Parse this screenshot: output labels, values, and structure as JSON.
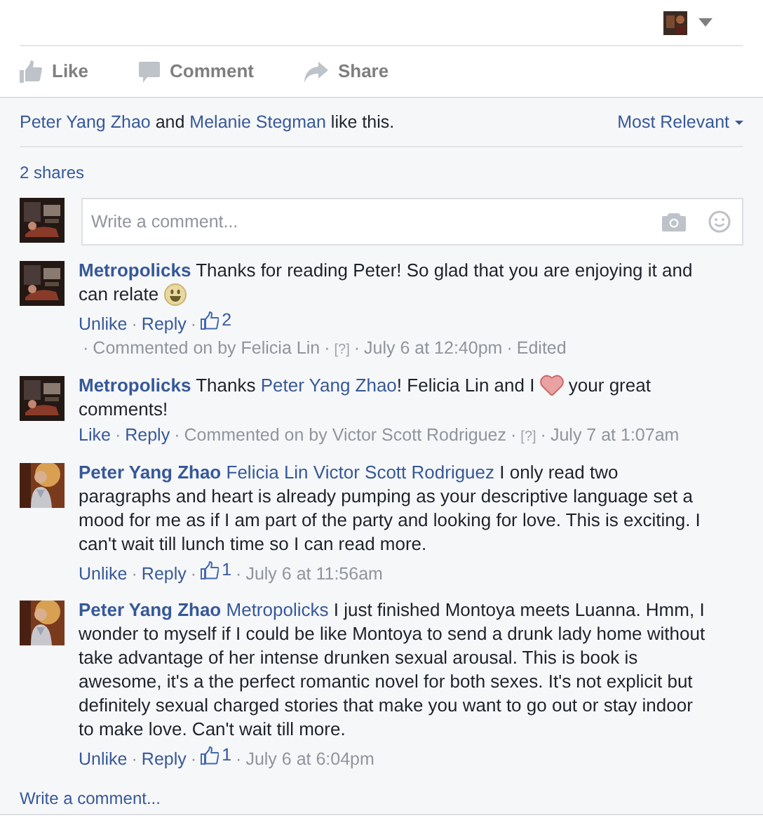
{
  "actions": [
    {
      "kind": "like",
      "label": "Like"
    },
    {
      "kind": "comment",
      "label": "Comment"
    },
    {
      "kind": "share",
      "label": "Share"
    }
  ],
  "likes_summary": [
    {
      "kind": "link",
      "text": "Peter Yang Zhao"
    },
    {
      "kind": "text",
      "text": " and "
    },
    {
      "kind": "link",
      "text": "Melanie Stegman"
    },
    {
      "kind": "text",
      "text": " like this."
    }
  ],
  "sort": {
    "label": "Most Relevant"
  },
  "shares": "2 shares",
  "composer": {
    "placeholder": "Write a comment..."
  },
  "separator": "·",
  "comments": [
    {
      "author": "Metropolicks",
      "avatar": {
        "kind": "book"
      },
      "body": [
        {
          "kind": "text",
          "text": "Thanks for reading Peter! So glad that you are enjoying it and can relate "
        },
        {
          "kind": "smiley"
        }
      ],
      "meta": [
        {
          "kind": "action",
          "text": "Unlike"
        },
        {
          "kind": "action",
          "text": "Reply"
        },
        {
          "kind": "likes",
          "text": "2"
        },
        {
          "kind": "info",
          "text": "Commented on by Felicia Lin"
        },
        {
          "kind": "help",
          "text": "[?]"
        },
        {
          "kind": "time",
          "text": "July 6 at 12:40pm"
        },
        {
          "kind": "info",
          "text": "Edited"
        }
      ]
    },
    {
      "author": "Metropolicks",
      "avatar": {
        "kind": "book"
      },
      "body": [
        {
          "kind": "text",
          "text": "Thanks "
        },
        {
          "kind": "link",
          "text": "Peter Yang Zhao"
        },
        {
          "kind": "text",
          "text": "! Felicia Lin and I "
        },
        {
          "kind": "heart"
        },
        {
          "kind": "text",
          "text": " your great comments!"
        }
      ],
      "meta": [
        {
          "kind": "action",
          "text": "Like"
        },
        {
          "kind": "action",
          "text": "Reply"
        },
        {
          "kind": "info",
          "text": "Commented on by Victor Scott Rodriguez"
        },
        {
          "kind": "help",
          "text": "[?]"
        },
        {
          "kind": "time",
          "text": "July 7 at 1:07am"
        }
      ]
    },
    {
      "author": "Peter Yang Zhao",
      "avatar": {
        "kind": "person"
      },
      "body": [
        {
          "kind": "link",
          "text": "Felicia Lin"
        },
        {
          "kind": "link",
          "text": "Victor Scott Rodriguez"
        },
        {
          "kind": "text",
          "text": " I only read two paragraphs and heart is already pumping as your descriptive language set a mood for me as if I am part of the party and looking for love. This is exciting. I can't wait till lunch time so I can read more."
        }
      ],
      "meta": [
        {
          "kind": "action",
          "text": "Unlike"
        },
        {
          "kind": "action",
          "text": "Reply"
        },
        {
          "kind": "likes",
          "text": "1"
        },
        {
          "kind": "time",
          "text": "July 6 at 11:56am"
        }
      ]
    },
    {
      "author": "Peter Yang Zhao",
      "avatar": {
        "kind": "person"
      },
      "body": [
        {
          "kind": "link",
          "text": "Metropolicks"
        },
        {
          "kind": "text",
          "text": " I just finished Montoya meets Luanna. Hmm, I wonder to myself if I could be like Montoya to send a drunk lady home without take advantage of her intense drunken sexual arousal. This is book is awesome, it's a the perfect romantic novel for both sexes. It's not explicit but definitely sexual charged stories that make you want to go out or stay indoor to make love. Can't wait till more."
        }
      ],
      "meta": [
        {
          "kind": "action",
          "text": "Unlike"
        },
        {
          "kind": "action",
          "text": "Reply"
        },
        {
          "kind": "likes",
          "text": "1"
        },
        {
          "kind": "time",
          "text": "July 6 at 6:04pm"
        }
      ]
    }
  ],
  "write_link": "Write a comment..."
}
